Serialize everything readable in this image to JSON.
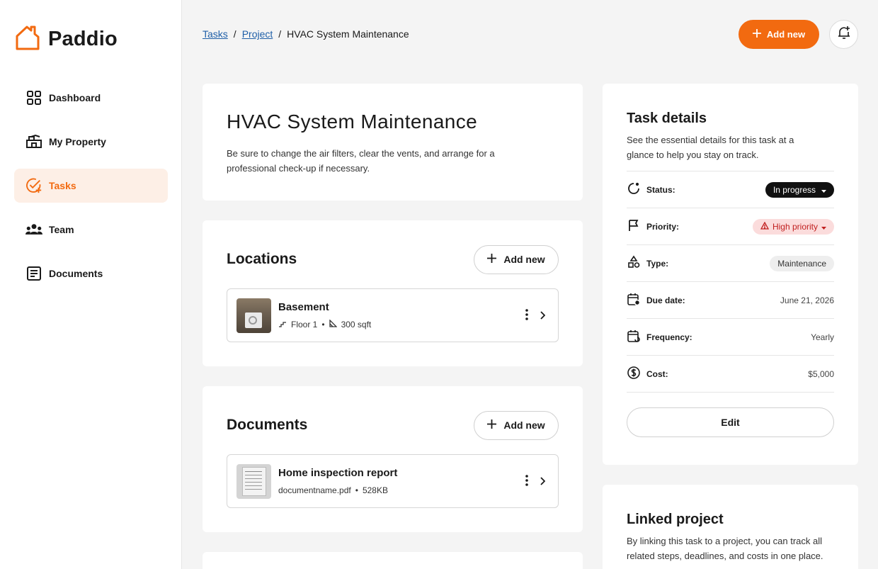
{
  "app": {
    "name": "Paddio",
    "brand_color": "#f26a10"
  },
  "sidebar": {
    "items": [
      {
        "label": "Dashboard",
        "icon": "dashboard-icon",
        "active": false
      },
      {
        "label": "My Property",
        "icon": "property-icon",
        "active": false
      },
      {
        "label": "Tasks",
        "icon": "tasks-icon",
        "active": true
      },
      {
        "label": "Team",
        "icon": "team-icon",
        "active": false
      },
      {
        "label": "Documents",
        "icon": "documents-icon",
        "active": false
      }
    ]
  },
  "breadcrumb": {
    "items": [
      "Tasks",
      "Project"
    ],
    "current": "HVAC System Maintenance"
  },
  "header": {
    "add_new_label": "Add new"
  },
  "task": {
    "title": "HVAC System Maintenance",
    "description": "Be sure to change the air filters, clear the vents, and arrange for a professional check-up if necessary."
  },
  "locations": {
    "title": "Locations",
    "add_label": "Add new",
    "items": [
      {
        "name": "Basement",
        "floor": "Floor 1",
        "size": "300 sqft"
      }
    ]
  },
  "documents": {
    "title": "Documents",
    "add_label": "Add new",
    "items": [
      {
        "name": "Home inspection report",
        "file": "documentname.pdf",
        "size": "528KB"
      }
    ]
  },
  "details": {
    "title": "Task details",
    "subtitle": "See the essential details for this task at a glance to help you stay on track.",
    "status_label": "Status:",
    "status_value": "In progress",
    "priority_label": "Priority:",
    "priority_value": "High priority",
    "type_label": "Type:",
    "type_value": "Maintenance",
    "due_label": "Due date:",
    "due_value": "June 21, 2026",
    "frequency_label": "Frequency:",
    "frequency_value": "Yearly",
    "cost_label": "Cost:",
    "cost_value": "$5,000",
    "edit_label": "Edit"
  },
  "linked": {
    "title": "Linked project",
    "description": "By linking this task to a project, you can track all related steps, deadlines, and costs in one place."
  }
}
